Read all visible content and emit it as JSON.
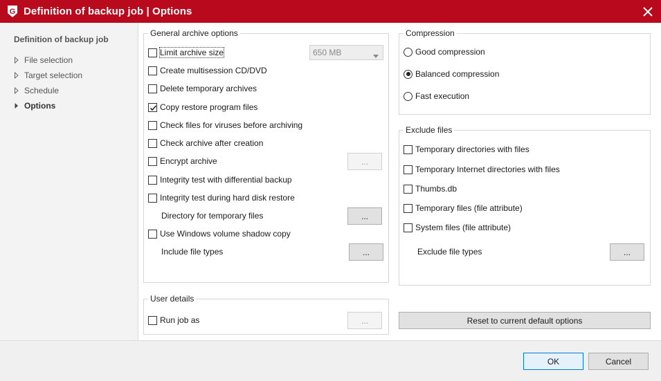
{
  "window": {
    "title": "Definition of backup job | Options",
    "logo_letter": "G",
    "accent_color": "#b8091d"
  },
  "sidebar": {
    "heading": "Definition of backup job",
    "items": [
      {
        "label": "File selection",
        "active": false
      },
      {
        "label": "Target selection",
        "active": false
      },
      {
        "label": "Schedule",
        "active": false
      },
      {
        "label": "Options",
        "active": true
      }
    ]
  },
  "general": {
    "legend": "General archive options",
    "limit_size": {
      "label": "Limit archive size",
      "checked": false
    },
    "size_select": {
      "value": "650 MB"
    },
    "multisession": {
      "label": "Create multisession CD/DVD",
      "checked": false
    },
    "delete_temp": {
      "label": "Delete temporary archives",
      "checked": false
    },
    "copy_restore": {
      "label": "Copy restore program files",
      "checked": true
    },
    "virus_check": {
      "label": "Check files for viruses before archiving",
      "checked": false
    },
    "check_archive": {
      "label": "Check archive after creation",
      "checked": false
    },
    "encrypt": {
      "label": "Encrypt archive",
      "checked": false
    },
    "integrity_diff": {
      "label": "Integrity test with differential backup",
      "checked": false
    },
    "integrity_restore": {
      "label": "Integrity test during hard disk restore",
      "checked": false
    },
    "temp_dir_label": "Directory for temporary files",
    "shadow_copy": {
      "label": "Use Windows volume shadow copy",
      "checked": false
    },
    "include_types_label": "Include file types",
    "browse_label": "..."
  },
  "user": {
    "legend": "User details",
    "run_as": {
      "label": "Run job as",
      "checked": false
    },
    "browse_label": "..."
  },
  "compression": {
    "legend": "Compression",
    "options": [
      {
        "label": "Good compression",
        "selected": false
      },
      {
        "label": "Balanced compression",
        "selected": true
      },
      {
        "label": "Fast execution",
        "selected": false
      }
    ]
  },
  "exclude": {
    "legend": "Exclude files",
    "items": [
      {
        "label": "Temporary directories with files",
        "checked": false
      },
      {
        "label": "Temporary Internet directories with files",
        "checked": false
      },
      {
        "label": "Thumbs.db",
        "checked": false
      },
      {
        "label": "Temporary files (file attribute)",
        "checked": false
      },
      {
        "label": "System files (file attribute)",
        "checked": false
      }
    ],
    "types_label": "Exclude file types",
    "browse_label": "..."
  },
  "reset_label": "Reset to current default options",
  "footer": {
    "ok_label": "OK",
    "cancel_label": "Cancel"
  }
}
